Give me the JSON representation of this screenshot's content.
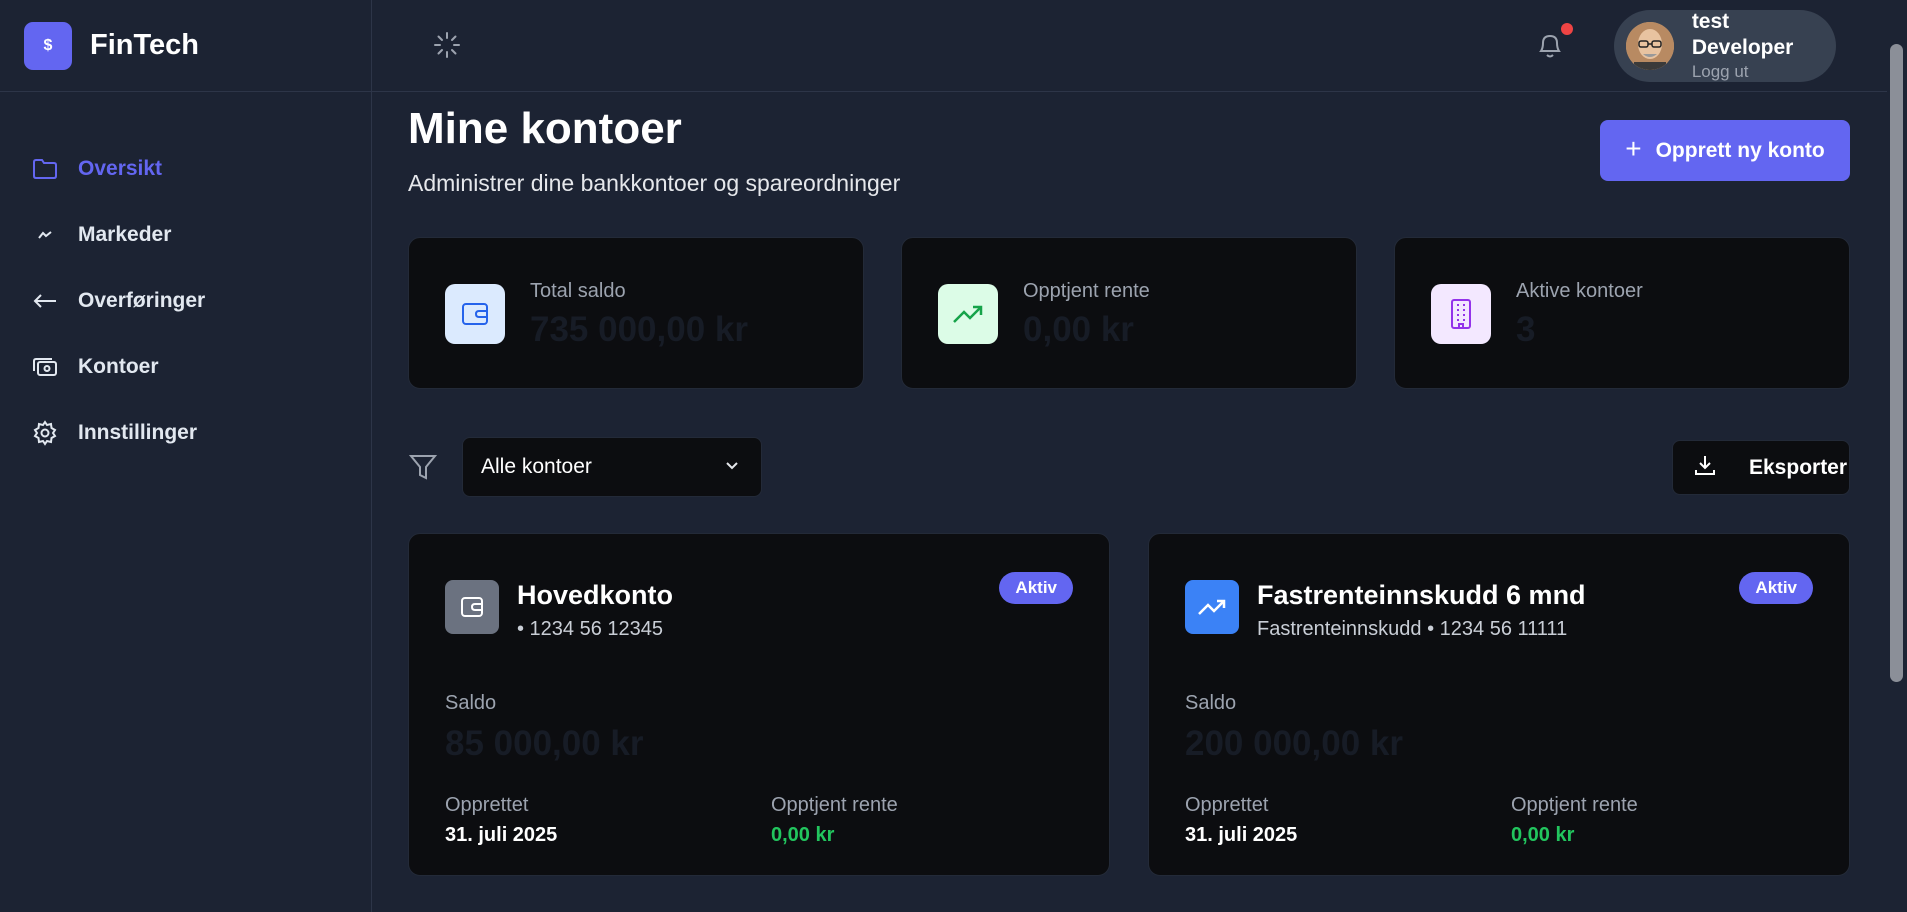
{
  "brand": {
    "logo_symbol": "$",
    "name": "FinTech",
    "color": "#6366f1"
  },
  "sidebar": {
    "items": [
      {
        "label": "Oversikt",
        "icon": "folder-icon",
        "active": true
      },
      {
        "label": "Markeder",
        "icon": "trend-icon",
        "active": false
      },
      {
        "label": "Overføringer",
        "icon": "arrow-left-icon",
        "active": false
      },
      {
        "label": "Kontoer",
        "icon": "cards-icon",
        "active": false
      },
      {
        "label": "Innstillinger",
        "icon": "gear-icon",
        "active": false
      }
    ]
  },
  "header": {
    "user": {
      "name": "test Developer",
      "logout": "Logg ut"
    },
    "notification_dot_color": "#ef4444"
  },
  "page": {
    "title": "Mine kontoer",
    "subtitle": "Administrer dine bankkontoer og spareordninger",
    "create_button": "Opprett ny konto"
  },
  "stats": [
    {
      "label": "Total saldo",
      "value": "735 000,00 kr",
      "icon": "wallet-icon"
    },
    {
      "label": "Opptjent rente",
      "value": "0,00 kr",
      "icon": "trending-up-icon"
    },
    {
      "label": "Aktive kontoer",
      "value": "3",
      "icon": "building-icon"
    }
  ],
  "toolbar": {
    "filter_selected": "Alle kontoer",
    "export_label": "Eksporter"
  },
  "accounts": [
    {
      "name": "Hovedkonto",
      "number": "• 1234 56 12345",
      "status": "Aktiv",
      "balance_label": "Saldo",
      "balance": "85 000,00 kr",
      "created_label": "Opprettet",
      "created": "31. juli 2025",
      "interest_label": "Opptjent rente",
      "interest": "0,00 kr",
      "icon": "wallet-icon"
    },
    {
      "name": "Fastrenteinnskudd 6 mnd",
      "number": "Fastrenteinnskudd • 1234 56 11111",
      "status": "Aktiv",
      "balance_label": "Saldo",
      "balance": "200 000,00 kr",
      "created_label": "Opprettet",
      "created": "31. juli 2025",
      "interest_label": "Opptjent rente",
      "interest": "0,00 kr",
      "icon": "trending-up-icon"
    }
  ]
}
